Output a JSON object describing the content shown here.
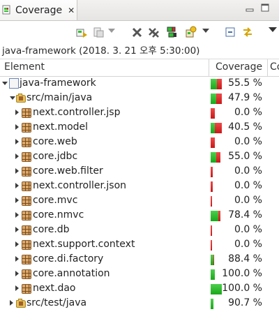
{
  "tab": {
    "title": "Coverage",
    "close": "✕"
  },
  "session": "java-framework (2018. 3. 21 오후 5:30:00)",
  "columns": {
    "element": "Element",
    "coverage": "Coverage",
    "extra": "Co"
  },
  "colors": {
    "covered": "#2fbf2f",
    "missed": "#d82a2a"
  },
  "rows": [
    {
      "label": "java-framework",
      "pct": "55.5 %",
      "coverage": 0.555,
      "icon": "project-icon",
      "expanded": true,
      "depth": 0
    },
    {
      "label": "src/main/java",
      "pct": "47.9 %",
      "coverage": 0.479,
      "icon": "source-folder-icon",
      "expanded": true,
      "depth": 1
    },
    {
      "label": "next.controller.jsp",
      "pct": "0.0 %",
      "coverage": 0.0,
      "icon": "package-icon",
      "expanded": false,
      "depth": 2
    },
    {
      "label": "next.model",
      "pct": "40.5 %",
      "coverage": 0.405,
      "icon": "package-icon",
      "expanded": false,
      "depth": 2
    },
    {
      "label": "core.web",
      "pct": "0.0 %",
      "coverage": 0.0,
      "icon": "package-icon",
      "expanded": false,
      "depth": 2
    },
    {
      "label": "core.jdbc",
      "pct": "55.0 %",
      "coverage": 0.55,
      "icon": "package-icon",
      "expanded": false,
      "depth": 2
    },
    {
      "label": "core.web.filter",
      "pct": "0.0 %",
      "coverage": 0.0,
      "icon": "package-icon",
      "expanded": false,
      "depth": 2
    },
    {
      "label": "next.controller.json",
      "pct": "0.0 %",
      "coverage": 0.0,
      "icon": "package-icon",
      "expanded": false,
      "depth": 2
    },
    {
      "label": "core.mvc",
      "pct": "0.0 %",
      "coverage": 0.0,
      "icon": "package-icon",
      "expanded": false,
      "depth": 2
    },
    {
      "label": "core.nmvc",
      "pct": "78.4 %",
      "coverage": 0.784,
      "icon": "package-icon",
      "expanded": false,
      "depth": 2
    },
    {
      "label": "core.db",
      "pct": "0.0 %",
      "coverage": 0.0,
      "icon": "package-icon",
      "expanded": false,
      "depth": 2
    },
    {
      "label": "next.support.context",
      "pct": "0.0 %",
      "coverage": 0.0,
      "icon": "package-icon",
      "expanded": false,
      "depth": 2
    },
    {
      "label": "core.di.factory",
      "pct": "88.4 %",
      "coverage": 0.884,
      "icon": "package-icon",
      "expanded": false,
      "depth": 2
    },
    {
      "label": "core.annotation",
      "pct": "100.0 %",
      "coverage": 1.0,
      "icon": "package-icon",
      "expanded": false,
      "depth": 2
    },
    {
      "label": "next.dao",
      "pct": "100.0 %",
      "coverage": 1.0,
      "icon": "package-icon",
      "expanded": false,
      "depth": 2
    },
    {
      "label": "src/test/java",
      "pct": "90.7 %",
      "coverage": 0.907,
      "icon": "source-folder-icon",
      "expanded": false,
      "depth": 1
    }
  ],
  "bar_widths_rel": [
    1.0,
    1.0,
    0.35,
    1.0,
    0.4,
    0.9,
    0.2,
    0.2,
    0.12,
    0.9,
    0.07,
    0.07,
    0.3,
    0.35,
    1.0,
    0.25
  ],
  "toolbar": {
    "icons": [
      "relaunch-icon",
      "coverage-session-icon",
      "session-dropdown-icon",
      "remove-session-icon",
      "remove-all-sessions-icon",
      "merge-sessions-icon",
      "import-icon",
      "import-dropdown-icon",
      "collapse-all-icon",
      "link-with-editor-icon",
      "view-menu-icon"
    ]
  }
}
